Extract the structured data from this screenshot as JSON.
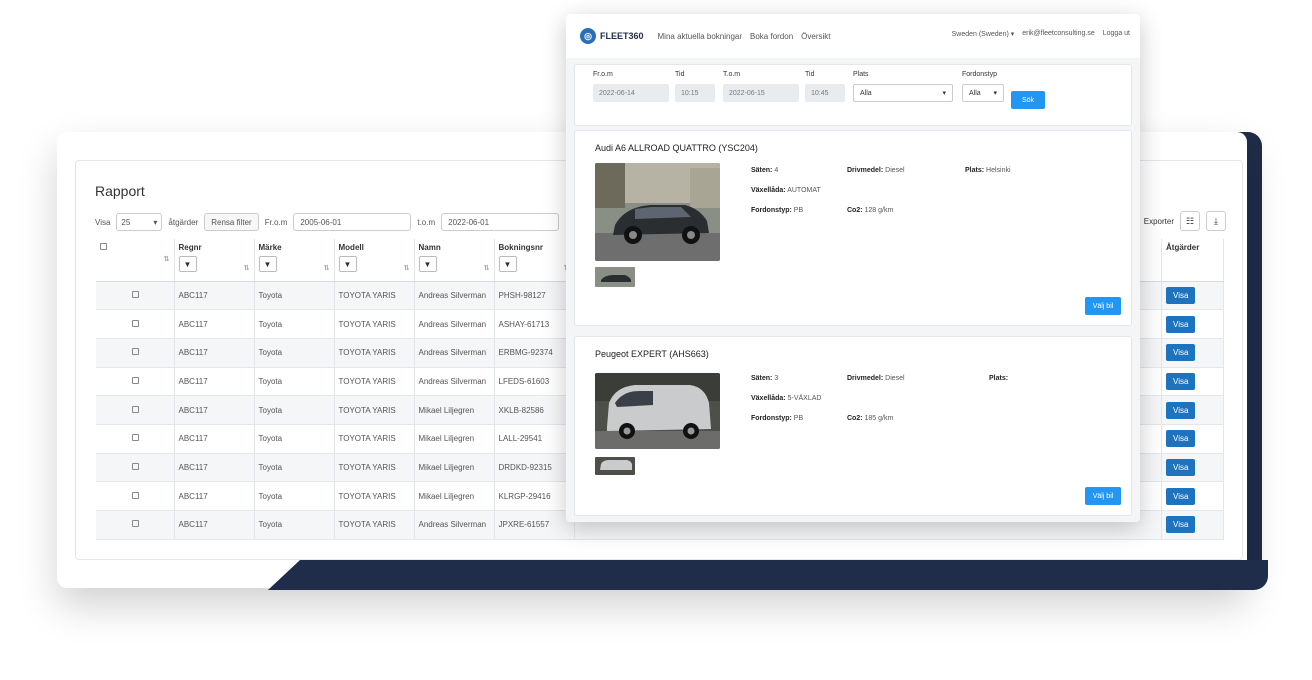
{
  "report": {
    "title": "Rapport",
    "toolbar": {
      "show_label": "Visa",
      "page_size": "25",
      "entries_label": "åtgärder",
      "filter_button": "Rensa filter",
      "from_label": "Fr.o.m",
      "from_value": "2005-06-01",
      "to_label": "t.o.m",
      "to_value": "2022-06-01",
      "export_label": "Exporter"
    },
    "columns": [
      "Regnr",
      "Märke",
      "Modell",
      "Namn",
      "Bokningsnr",
      "Åtgärder"
    ],
    "rows": [
      {
        "regnr": "ABC117",
        "make": "Toyota",
        "model": "TOYOTA YARIS",
        "name": "Andreas Silverman",
        "booking": "PHSH-98127",
        "action": "Visa"
      },
      {
        "regnr": "ABC117",
        "make": "Toyota",
        "model": "TOYOTA YARIS",
        "name": "Andreas Silverman",
        "booking": "ASHAY-61713",
        "action": "Visa"
      },
      {
        "regnr": "ABC117",
        "make": "Toyota",
        "model": "TOYOTA YARIS",
        "name": "Andreas Silverman",
        "booking": "ERBMG-92374",
        "action": "Visa"
      },
      {
        "regnr": "ABC117",
        "make": "Toyota",
        "model": "TOYOTA YARIS",
        "name": "Andreas Silverman",
        "booking": "LFEDS-61603",
        "action": "Visa"
      },
      {
        "regnr": "ABC117",
        "make": "Toyota",
        "model": "TOYOTA YARIS",
        "name": "Mikael Liljegren",
        "booking": "XKLB-82586",
        "action": "Visa"
      },
      {
        "regnr": "ABC117",
        "make": "Toyota",
        "model": "TOYOTA YARIS",
        "name": "Mikael Liljegren",
        "booking": "LALL-29541",
        "action": "Visa"
      },
      {
        "regnr": "ABC117",
        "make": "Toyota",
        "model": "TOYOTA YARIS",
        "name": "Mikael Liljegren",
        "booking": "DRDKD-92315",
        "action": "Visa"
      },
      {
        "regnr": "ABC117",
        "make": "Toyota",
        "model": "TOYOTA YARIS",
        "name": "Mikael Liljegren",
        "booking": "KLRGP-29416",
        "action": "Visa"
      },
      {
        "regnr": "ABC117",
        "make": "Toyota",
        "model": "TOYOTA YARIS",
        "name": "Andreas Silverman",
        "booking": "JPXRE-61557",
        "action": "Visa"
      }
    ]
  },
  "app": {
    "brand": "FLEET360",
    "nav": [
      "Mina aktuella bokningar",
      "Boka fordon",
      "Översikt"
    ],
    "user_menu": "Sweden (Sweden)",
    "email": "erik@fleetconsulting.se",
    "logout": "Logga ut",
    "search": {
      "from_date_label": "Fr.o.m",
      "from_date": "2022-06-14",
      "from_time_label": "Tid",
      "from_time": "10:15",
      "to_date_label": "T.o.m",
      "to_date": "2022-06-15",
      "to_time_label": "Tid",
      "to_time": "10:45",
      "place_label": "Plats",
      "place_value": "Alla",
      "type_label": "Fordonstyp",
      "type_value": "Alla",
      "search_button": "Sök"
    },
    "cars": [
      {
        "title": "Audi A6 ALLROAD QUATTRO (YSC204)",
        "seats_label": "Säten:",
        "seats": "4",
        "gear_label": "Växellåda:",
        "gear": "AUTOMAT",
        "fuel_label": "Drivmedel:",
        "fuel": "Diesel",
        "place_label": "Plats:",
        "place": "Helsinki",
        "type_label": "Fordonstyp:",
        "type": "PB",
        "co2_label": "Co2:",
        "co2": "128 g/km",
        "book_button": "Välj bil"
      },
      {
        "title": "Peugeot EXPERT (AHS663)",
        "seats_label": "Säten:",
        "seats": "3",
        "gear_label": "Växellåda:",
        "gear": "5-VÄXLAD",
        "fuel_label": "Drivmedel:",
        "fuel": "Diesel",
        "place_label": "Plats:",
        "place": "",
        "type_label": "Fordonstyp:",
        "type": "PB",
        "co2_label": "Co2:",
        "co2": "185 g/km",
        "book_button": "Välj bil"
      }
    ]
  },
  "colors": {
    "navy": "#1f2d4a",
    "primary": "#2196f3",
    "action": "#1e73be"
  }
}
